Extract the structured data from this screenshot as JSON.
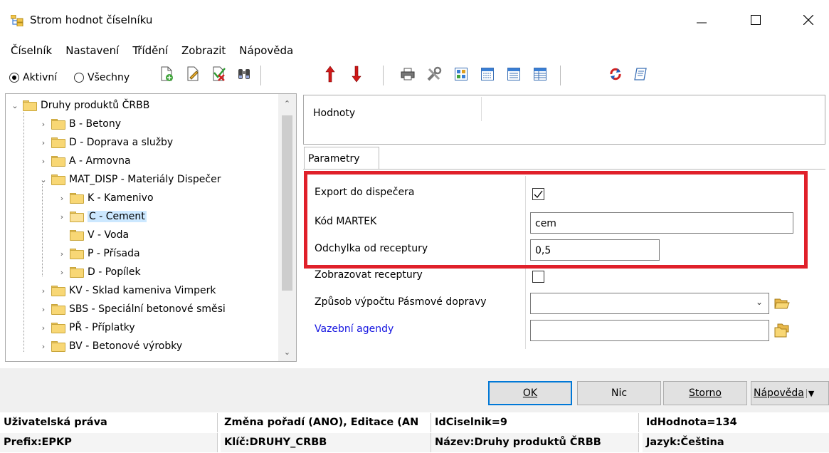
{
  "window": {
    "title": "Strom hodnot číselníku",
    "minimize_glyph": "—",
    "maximize_glyph": "☐",
    "close_glyph": "✕"
  },
  "menu": [
    "Číselník",
    "Nastavení",
    "Třídění",
    "Zobrazit",
    "Nápověda"
  ],
  "toolbar": {
    "radio_active": "Aktivní",
    "radio_all": "Všechny",
    "selected_radio": "Aktivní",
    "icons": [
      "new-document-icon",
      "edit-document-icon",
      "delete-check-icon",
      "binoculars-icon",
      "move-up-icon",
      "move-down-icon",
      "print-icon",
      "tools-icon",
      "grid-view-icon",
      "dots-view-icon",
      "list-view-icon",
      "table-view-icon",
      "refresh-icon",
      "script-icon"
    ]
  },
  "tree": {
    "root": "Druhy produktů ČRBB",
    "items": [
      {
        "label": "B - Betony"
      },
      {
        "label": "D - Doprava a služby"
      },
      {
        "label": "A - Armovna"
      },
      {
        "label": "MAT_DISP - Materiály Dispečer"
      },
      {
        "label": "K - Kamenivo"
      },
      {
        "label": "C - Cement"
      },
      {
        "label": "V - Voda"
      },
      {
        "label": "P - Přísada"
      },
      {
        "label": "D - Popílek"
      },
      {
        "label": "KV - Sklad kameniva Vimperk"
      },
      {
        "label": "SBS - Speciální betonové směsi"
      },
      {
        "label": "PŘ - Příplatky"
      },
      {
        "label": "BV - Betonové výrobky"
      }
    ],
    "selected": "C - Cement"
  },
  "values_section": {
    "label": "Hodnoty"
  },
  "tab": {
    "label": "Parametry"
  },
  "params": {
    "export_label": "Export do dispečera",
    "export_checked": true,
    "kod_label": "Kód MARTEK",
    "kod_value": "cem",
    "odchylka_label": "Odchylka od receptury",
    "odchylka_value": "0,5",
    "zobrazovat_label": "Zobrazovat receptury",
    "zobrazovat_checked": false,
    "zpusob_label": "Způsob výpočtu Pásmové dopravy",
    "zpusob_value": "",
    "vazebni_label": "Vazební agendy",
    "vazebni_value": ""
  },
  "buttons": {
    "ok": "OK",
    "nic": "Nic",
    "storno": "Storno",
    "napoveda": "Nápověda"
  },
  "status": {
    "row1": [
      "Uživatelská práva",
      "Změna pořadí (ANO), Editace (AN",
      "IdCiselnik=9",
      "IdHodnota=134"
    ],
    "row2": [
      "Prefix:EPKP",
      "Klíč:DRUHY_CRBB",
      "Název:Druhy produktů ČRBB",
      "Jazyk:Čeština"
    ]
  },
  "colors": {
    "highlight_frame": "#e0202a",
    "selection": "#cce8ff",
    "link": "#1515e0",
    "folder": "#f8d775"
  }
}
